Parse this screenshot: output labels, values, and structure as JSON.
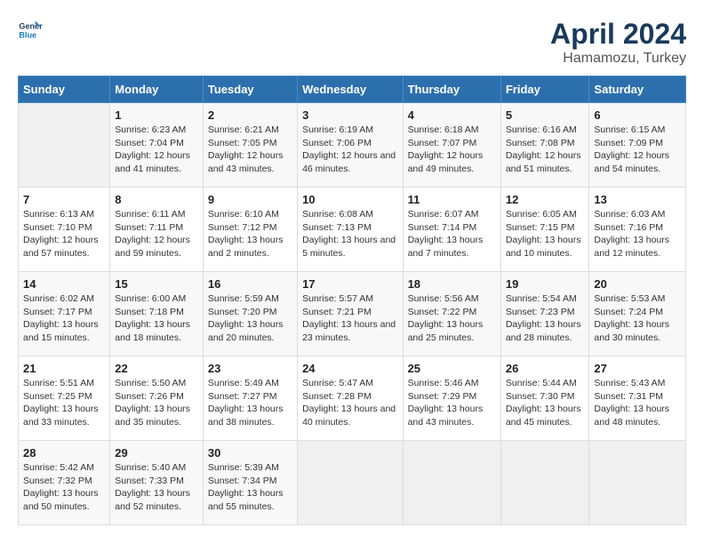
{
  "logo": {
    "line1": "General",
    "line2": "Blue"
  },
  "title": "April 2024",
  "subtitle": "Hamamozu, Turkey",
  "days_of_week": [
    "Sunday",
    "Monday",
    "Tuesday",
    "Wednesday",
    "Thursday",
    "Friday",
    "Saturday"
  ],
  "weeks": [
    [
      {
        "day": "",
        "empty": true
      },
      {
        "day": "1",
        "sunrise": "6:23 AM",
        "sunset": "7:04 PM",
        "daylight": "12 hours and 41 minutes."
      },
      {
        "day": "2",
        "sunrise": "6:21 AM",
        "sunset": "7:05 PM",
        "daylight": "12 hours and 43 minutes."
      },
      {
        "day": "3",
        "sunrise": "6:19 AM",
        "sunset": "7:06 PM",
        "daylight": "12 hours and 46 minutes."
      },
      {
        "day": "4",
        "sunrise": "6:18 AM",
        "sunset": "7:07 PM",
        "daylight": "12 hours and 49 minutes."
      },
      {
        "day": "5",
        "sunrise": "6:16 AM",
        "sunset": "7:08 PM",
        "daylight": "12 hours and 51 minutes."
      },
      {
        "day": "6",
        "sunrise": "6:15 AM",
        "sunset": "7:09 PM",
        "daylight": "12 hours and 54 minutes."
      }
    ],
    [
      {
        "day": "7",
        "sunrise": "6:13 AM",
        "sunset": "7:10 PM",
        "daylight": "12 hours and 57 minutes."
      },
      {
        "day": "8",
        "sunrise": "6:11 AM",
        "sunset": "7:11 PM",
        "daylight": "12 hours and 59 minutes."
      },
      {
        "day": "9",
        "sunrise": "6:10 AM",
        "sunset": "7:12 PM",
        "daylight": "13 hours and 2 minutes."
      },
      {
        "day": "10",
        "sunrise": "6:08 AM",
        "sunset": "7:13 PM",
        "daylight": "13 hours and 5 minutes."
      },
      {
        "day": "11",
        "sunrise": "6:07 AM",
        "sunset": "7:14 PM",
        "daylight": "13 hours and 7 minutes."
      },
      {
        "day": "12",
        "sunrise": "6:05 AM",
        "sunset": "7:15 PM",
        "daylight": "13 hours and 10 minutes."
      },
      {
        "day": "13",
        "sunrise": "6:03 AM",
        "sunset": "7:16 PM",
        "daylight": "13 hours and 12 minutes."
      }
    ],
    [
      {
        "day": "14",
        "sunrise": "6:02 AM",
        "sunset": "7:17 PM",
        "daylight": "13 hours and 15 minutes."
      },
      {
        "day": "15",
        "sunrise": "6:00 AM",
        "sunset": "7:18 PM",
        "daylight": "13 hours and 18 minutes."
      },
      {
        "day": "16",
        "sunrise": "5:59 AM",
        "sunset": "7:20 PM",
        "daylight": "13 hours and 20 minutes."
      },
      {
        "day": "17",
        "sunrise": "5:57 AM",
        "sunset": "7:21 PM",
        "daylight": "13 hours and 23 minutes."
      },
      {
        "day": "18",
        "sunrise": "5:56 AM",
        "sunset": "7:22 PM",
        "daylight": "13 hours and 25 minutes."
      },
      {
        "day": "19",
        "sunrise": "5:54 AM",
        "sunset": "7:23 PM",
        "daylight": "13 hours and 28 minutes."
      },
      {
        "day": "20",
        "sunrise": "5:53 AM",
        "sunset": "7:24 PM",
        "daylight": "13 hours and 30 minutes."
      }
    ],
    [
      {
        "day": "21",
        "sunrise": "5:51 AM",
        "sunset": "7:25 PM",
        "daylight": "13 hours and 33 minutes."
      },
      {
        "day": "22",
        "sunrise": "5:50 AM",
        "sunset": "7:26 PM",
        "daylight": "13 hours and 35 minutes."
      },
      {
        "day": "23",
        "sunrise": "5:49 AM",
        "sunset": "7:27 PM",
        "daylight": "13 hours and 38 minutes."
      },
      {
        "day": "24",
        "sunrise": "5:47 AM",
        "sunset": "7:28 PM",
        "daylight": "13 hours and 40 minutes."
      },
      {
        "day": "25",
        "sunrise": "5:46 AM",
        "sunset": "7:29 PM",
        "daylight": "13 hours and 43 minutes."
      },
      {
        "day": "26",
        "sunrise": "5:44 AM",
        "sunset": "7:30 PM",
        "daylight": "13 hours and 45 minutes."
      },
      {
        "day": "27",
        "sunrise": "5:43 AM",
        "sunset": "7:31 PM",
        "daylight": "13 hours and 48 minutes."
      }
    ],
    [
      {
        "day": "28",
        "sunrise": "5:42 AM",
        "sunset": "7:32 PM",
        "daylight": "13 hours and 50 minutes."
      },
      {
        "day": "29",
        "sunrise": "5:40 AM",
        "sunset": "7:33 PM",
        "daylight": "13 hours and 52 minutes."
      },
      {
        "day": "30",
        "sunrise": "5:39 AM",
        "sunset": "7:34 PM",
        "daylight": "13 hours and 55 minutes."
      },
      {
        "day": "",
        "empty": true
      },
      {
        "day": "",
        "empty": true
      },
      {
        "day": "",
        "empty": true
      },
      {
        "day": "",
        "empty": true
      }
    ]
  ]
}
